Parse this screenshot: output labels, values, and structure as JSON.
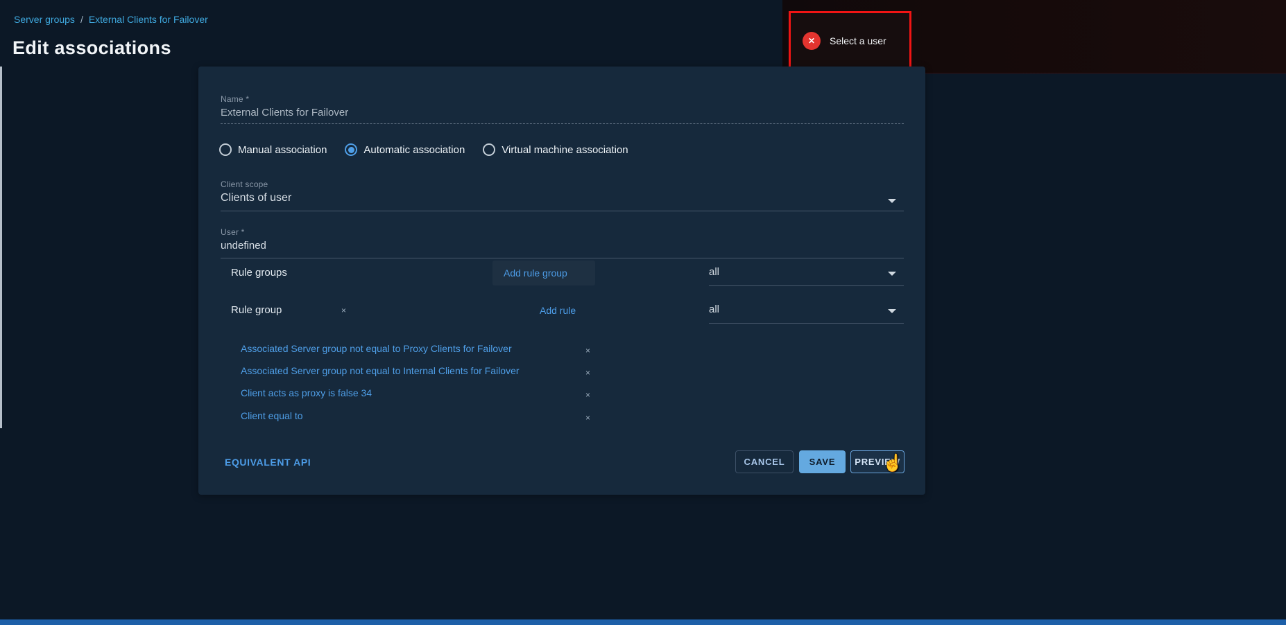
{
  "breadcrumb": {
    "items": [
      "Server groups",
      "External Clients for Failover"
    ],
    "separator": "/"
  },
  "page": {
    "title": "Edit associations"
  },
  "toast": {
    "message": "Select a user"
  },
  "icons": {
    "error_x": "✕",
    "remove_x": "×",
    "cursor_hand": "☝"
  },
  "colors": {
    "accent_blue": "#4d9de8",
    "error_red": "#e3342f",
    "annotation_red": "#f01414",
    "save_blue": "#64a9e0",
    "card_bg": "#16293c",
    "page_bg": "#0c1826"
  },
  "form": {
    "name": {
      "label": "Name *",
      "value": "External Clients for Failover"
    },
    "association_options": [
      {
        "label": "Manual association",
        "selected": false
      },
      {
        "label": "Automatic association",
        "selected": true
      },
      {
        "label": "Virtual machine association",
        "selected": false
      }
    ],
    "client_scope": {
      "label": "Client scope",
      "value": "Clients of user"
    },
    "user": {
      "label": "User *",
      "value": "undefined"
    },
    "rule_groups_row": {
      "label": "Rule groups",
      "action_label": "Add rule group",
      "match_value": "all"
    },
    "rule_group_row": {
      "label": "Rule group",
      "action_label": "Add rule",
      "match_value": "all"
    },
    "rules": [
      {
        "text": "Associated Server group not equal to Proxy Clients for Failover"
      },
      {
        "text": "Associated Server group not equal to Internal Clients for Failover"
      },
      {
        "text": "Client acts as proxy is false 34"
      },
      {
        "text": "Client equal to"
      }
    ],
    "footer": {
      "api_link": "EQUIVALENT API",
      "cancel": "CANCEL",
      "save": "SAVE",
      "preview": "PREVIEW"
    }
  }
}
